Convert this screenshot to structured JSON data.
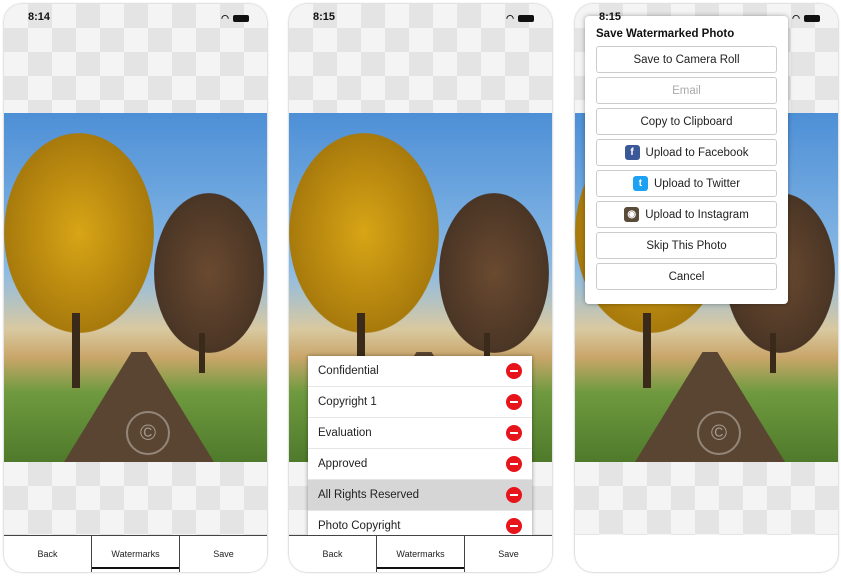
{
  "phones": [
    {
      "time": "8:14",
      "tabs": [
        "Back",
        "Watermarks",
        "Save"
      ]
    },
    {
      "time": "8:15",
      "tabs": [
        "Back",
        "Watermarks",
        "Save"
      ],
      "watermarks": [
        "Confidential",
        "Copyright 1",
        "Evaluation",
        "Approved",
        "All Rights Reserved",
        "Photo Copyright"
      ],
      "selected": "All Rights Reserved"
    },
    {
      "time": "8:15",
      "dialog": {
        "title": "Save Watermarked Photo",
        "buttons": [
          {
            "label": "Save to Camera Roll"
          },
          {
            "label": "Email",
            "disabled": true
          },
          {
            "label": "Copy to Clipboard"
          },
          {
            "label": "Upload to Facebook",
            "icon": "facebook-icon"
          },
          {
            "label": "Upload to Twitter",
            "icon": "twitter-icon"
          },
          {
            "label": "Upload to Instagram",
            "icon": "instagram-icon"
          },
          {
            "label": "Skip This Photo"
          },
          {
            "label": "Cancel"
          }
        ]
      }
    }
  ],
  "watermark_glyph": "©",
  "colors": {
    "delete": "#e8141b",
    "facebook": "#3b5998",
    "twitter": "#1da1f2"
  }
}
